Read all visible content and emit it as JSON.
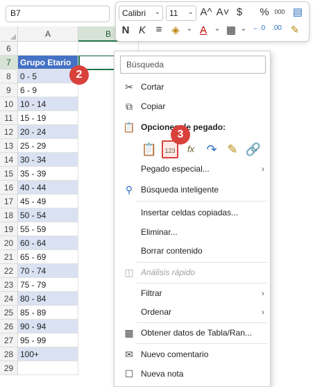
{
  "formula_bar": {
    "name_box": "B7"
  },
  "columns": [
    {
      "letter": "A"
    },
    {
      "letter": "B"
    }
  ],
  "rows": [
    {
      "num": "6",
      "value": ""
    },
    {
      "num": "7",
      "value": "Grupo Etario"
    },
    {
      "num": "8",
      "value": "0 - 5"
    },
    {
      "num": "9",
      "value": "6 - 9"
    },
    {
      "num": "10",
      "value": "10 - 14"
    },
    {
      "num": "11",
      "value": "15 - 19"
    },
    {
      "num": "12",
      "value": "20 - 24"
    },
    {
      "num": "13",
      "value": "25 - 29"
    },
    {
      "num": "14",
      "value": "30 - 34"
    },
    {
      "num": "15",
      "value": "35 - 39"
    },
    {
      "num": "16",
      "value": "40 - 44"
    },
    {
      "num": "17",
      "value": "45 - 49"
    },
    {
      "num": "18",
      "value": "50 - 54"
    },
    {
      "num": "19",
      "value": "55 - 59"
    },
    {
      "num": "20",
      "value": "60 - 64"
    },
    {
      "num": "21",
      "value": "65 - 69"
    },
    {
      "num": "22",
      "value": "70 - 74"
    },
    {
      "num": "23",
      "value": "75 - 79"
    },
    {
      "num": "24",
      "value": "80 - 84"
    },
    {
      "num": "25",
      "value": "85 - 89"
    },
    {
      "num": "26",
      "value": "90 - 94"
    },
    {
      "num": "27",
      "value": "95 - 99"
    },
    {
      "num": "28",
      "value": "100+"
    },
    {
      "num": "29",
      "value": ""
    }
  ],
  "badges": {
    "step2": "2",
    "step3": "3"
  },
  "mini_toolbar": {
    "font_name": "Calibri",
    "font_size": "11",
    "increase_font": "A^",
    "decrease_font": "A˅",
    "currency": "$",
    "percent": "%",
    "thousands": "000",
    "bold": "N",
    "italic": "K"
  },
  "context_menu": {
    "search_placeholder": "Búsqueda",
    "cut": "Cortar",
    "copy": "Copiar",
    "paste_options": "Opciones de pegado:",
    "paste_special": "Pegado especial...",
    "smart_lookup": "Búsqueda inteligente",
    "insert_copied": "Insertar celdas copiadas...",
    "delete": "Eliminar...",
    "clear": "Borrar contenido",
    "quick_analysis": "Análisis rápido",
    "filter": "Filtrar",
    "sort": "Ordenar",
    "get_data": "Obtener datos de Tabla/Ran...",
    "new_comment": "Nuevo comentario",
    "new_note": "Nueva nota"
  },
  "colors": {
    "header_fill": "#4472c4",
    "band_fill": "#d9e1f2",
    "badge": "#d9413c",
    "selection": "#217346"
  }
}
